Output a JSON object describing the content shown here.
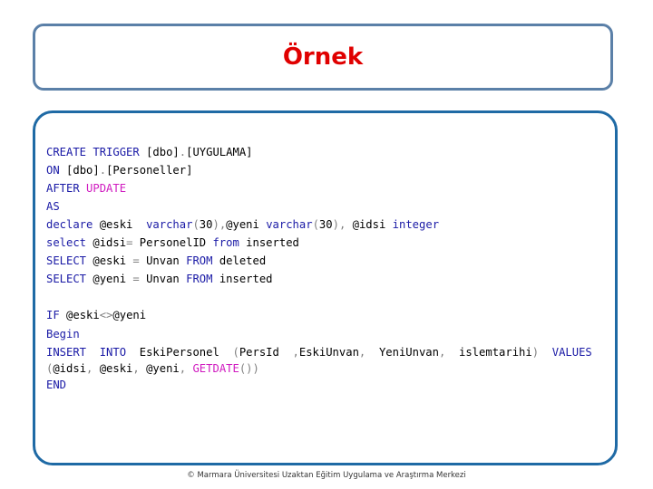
{
  "slide": {
    "title": "Örnek",
    "footer": "© Marmara Üniversitesi Uzaktan Eğitim Uygulama ve Araştırma Merkezi",
    "colors": {
      "title": "#e00000",
      "keyword": "#1a1aa6",
      "function": "#d01cc0",
      "operator": "#808080",
      "title_border": "#5b80a8",
      "content_border": "#1f6aa5"
    }
  },
  "code": {
    "l1": {
      "a": "CREATE",
      "b": " ",
      "c": "TRIGGER",
      "d": " [dbo]",
      "e": ".",
      "f": "[UYGULAMA]"
    },
    "l2": {
      "a": "ON",
      "b": " [dbo]",
      "c": ".",
      "d": "[Personeller]"
    },
    "l3": {
      "a": "AFTER",
      "b": " ",
      "c": "UPDATE"
    },
    "l4": {
      "a": "AS"
    },
    "l5": {
      "a": "declare",
      "b": " @eski  ",
      "c": "varchar",
      "d": "(",
      "e": "30",
      "f": "),",
      "g": "@yeni ",
      "h": "varchar",
      "i": "(",
      "j": "30",
      "k": "),",
      "l": " @idsi ",
      "m": "integer"
    },
    "l6": {
      "a": "select",
      "b": " @idsi",
      "c": "=",
      "d": " PersonelID ",
      "e": "from",
      "f": " inserted"
    },
    "l7": {
      "a": "SELECT",
      "b": " @eski ",
      "c": "=",
      "d": " Unvan ",
      "e": "FROM",
      "f": " deleted"
    },
    "l8": {
      "a": "SELECT",
      "b": " @yeni ",
      "c": "=",
      "d": " Unvan ",
      "e": "FROM",
      "f": " inserted"
    },
    "l9": {
      "a": "IF",
      "b": " @eski",
      "c": "<>",
      "d": "@yeni"
    },
    "l10": {
      "a": "Begin"
    },
    "l11": {
      "a": "INSERT",
      "b": "  ",
      "c": "INTO",
      "d": "  EskiPersonel  ",
      "e": "(",
      "f": "PersId  ",
      "g": ",",
      "h": "EskiUnvan",
      "i": ",",
      "j": "  YeniUnvan",
      "k": ",",
      "l": "  islemtarihi",
      "m": ")",
      "n": "  ",
      "o": "VALUES"
    },
    "l12": {
      "a": "(",
      "b": "@idsi",
      "c": ",",
      "d": " @eski",
      "e": ",",
      "f": " @yeni",
      "g": ",",
      "h": " ",
      "i": "GETDATE",
      "j": "())"
    },
    "l13": {
      "a": "END"
    }
  }
}
